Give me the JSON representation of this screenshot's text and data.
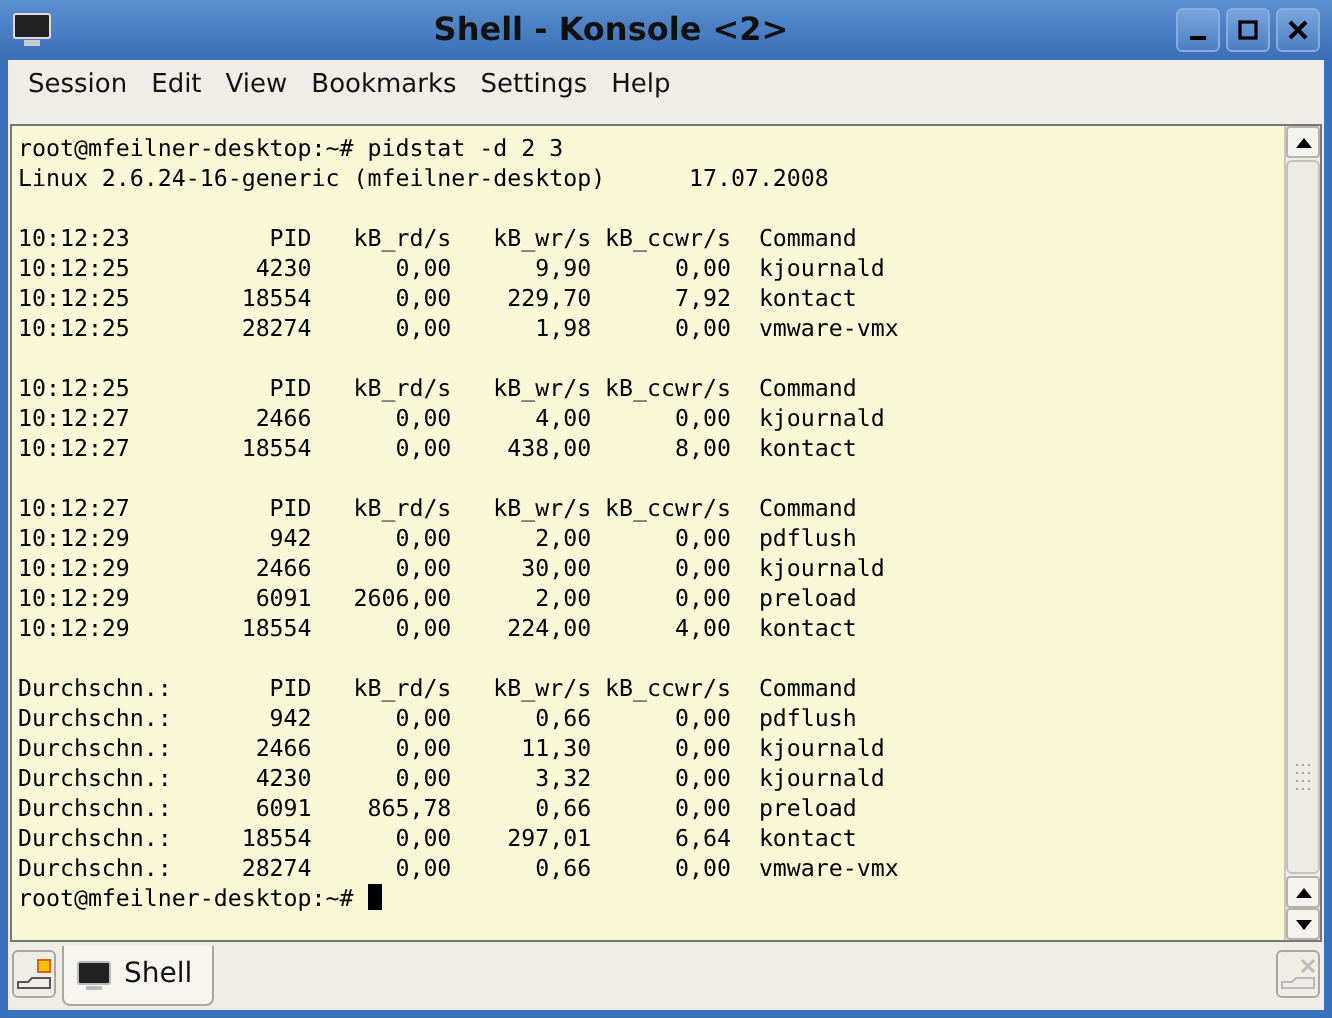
{
  "window": {
    "title": "Shell - Konsole <2>"
  },
  "menu": [
    "Session",
    "Edit",
    "View",
    "Bookmarks",
    "Settings",
    "Help"
  ],
  "terminal": {
    "intro": [
      "root@mfeilner-desktop:~# pidstat -d 2 3",
      "Linux 2.6.24-16-generic (mfeilner-desktop)      17.07.2008"
    ],
    "blocks": [
      [
        {
          "time": "10:12:23",
          "pid": "PID",
          "rd": "kB_rd/s",
          "wr": "kB_wr/s",
          "ccwr": "kB_ccwr/s",
          "command": "Command"
        },
        {
          "time": "10:12:25",
          "pid": "4230",
          "rd": "0,00",
          "wr": "9,90",
          "ccwr": "0,00",
          "command": "kjournald"
        },
        {
          "time": "10:12:25",
          "pid": "18554",
          "rd": "0,00",
          "wr": "229,70",
          "ccwr": "7,92",
          "command": "kontact"
        },
        {
          "time": "10:12:25",
          "pid": "28274",
          "rd": "0,00",
          "wr": "1,98",
          "ccwr": "0,00",
          "command": "vmware-vmx"
        }
      ],
      [
        {
          "time": "10:12:25",
          "pid": "PID",
          "rd": "kB_rd/s",
          "wr": "kB_wr/s",
          "ccwr": "kB_ccwr/s",
          "command": "Command"
        },
        {
          "time": "10:12:27",
          "pid": "2466",
          "rd": "0,00",
          "wr": "4,00",
          "ccwr": "0,00",
          "command": "kjournald"
        },
        {
          "time": "10:12:27",
          "pid": "18554",
          "rd": "0,00",
          "wr": "438,00",
          "ccwr": "8,00",
          "command": "kontact"
        }
      ],
      [
        {
          "time": "10:12:27",
          "pid": "PID",
          "rd": "kB_rd/s",
          "wr": "kB_wr/s",
          "ccwr": "kB_ccwr/s",
          "command": "Command"
        },
        {
          "time": "10:12:29",
          "pid": "942",
          "rd": "0,00",
          "wr": "2,00",
          "ccwr": "0,00",
          "command": "pdflush"
        },
        {
          "time": "10:12:29",
          "pid": "2466",
          "rd": "0,00",
          "wr": "30,00",
          "ccwr": "0,00",
          "command": "kjournald"
        },
        {
          "time": "10:12:29",
          "pid": "6091",
          "rd": "2606,00",
          "wr": "2,00",
          "ccwr": "0,00",
          "command": "preload"
        },
        {
          "time": "10:12:29",
          "pid": "18554",
          "rd": "0,00",
          "wr": "224,00",
          "ccwr": "4,00",
          "command": "kontact"
        }
      ],
      [
        {
          "time": "Durchschn.:",
          "pid": "PID",
          "rd": "kB_rd/s",
          "wr": "kB_wr/s",
          "ccwr": "kB_ccwr/s",
          "command": "Command"
        },
        {
          "time": "Durchschn.:",
          "pid": "942",
          "rd": "0,00",
          "wr": "0,66",
          "ccwr": "0,00",
          "command": "pdflush"
        },
        {
          "time": "Durchschn.:",
          "pid": "2466",
          "rd": "0,00",
          "wr": "11,30",
          "ccwr": "0,00",
          "command": "kjournald"
        },
        {
          "time": "Durchschn.:",
          "pid": "4230",
          "rd": "0,00",
          "wr": "3,32",
          "ccwr": "0,00",
          "command": "kjournald"
        },
        {
          "time": "Durchschn.:",
          "pid": "6091",
          "rd": "865,78",
          "wr": "0,66",
          "ccwr": "0,00",
          "command": "preload"
        },
        {
          "time": "Durchschn.:",
          "pid": "18554",
          "rd": "0,00",
          "wr": "297,01",
          "ccwr": "6,64",
          "command": "kontact"
        },
        {
          "time": "Durchschn.:",
          "pid": "28274",
          "rd": "0,00",
          "wr": "0,66",
          "ccwr": "0,00",
          "command": "vmware-vmx"
        }
      ]
    ],
    "prompt": "root@mfeilner-desktop:~#"
  },
  "tabs": [
    {
      "label": "Shell",
      "selected": true
    }
  ],
  "close_tab": {
    "disabled": true
  }
}
